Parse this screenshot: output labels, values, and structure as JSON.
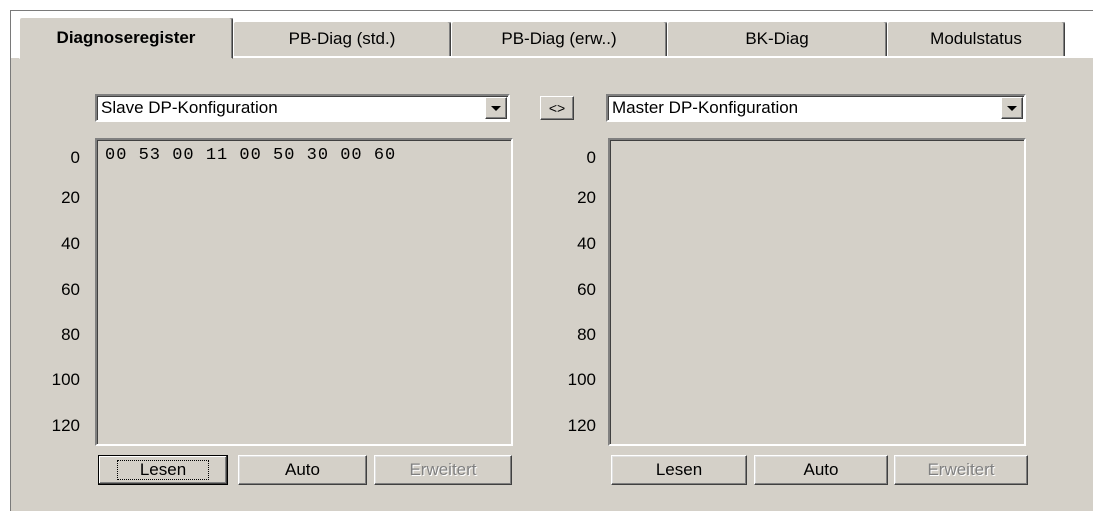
{
  "tabs": [
    {
      "label": "Diagnoseregister",
      "active": true
    },
    {
      "label": "PB-Diag (std.)",
      "active": false
    },
    {
      "label": "PB-Diag (erw..)",
      "active": false
    },
    {
      "label": "BK-Diag",
      "active": false
    },
    {
      "label": "Modulstatus",
      "active": false
    }
  ],
  "left": {
    "combo_value": "Slave DP-Konfiguration",
    "rows": [
      "0",
      "20",
      "40",
      "60",
      "80",
      "100",
      "120"
    ],
    "data_line": "00 53 00 11 00 50 30 00 60",
    "buttons": {
      "read": "Lesen",
      "auto": "Auto",
      "extended": "Erweitert"
    }
  },
  "swap_label": "<>",
  "right": {
    "combo_value": "Master DP-Konfiguration",
    "rows": [
      "0",
      "20",
      "40",
      "60",
      "80",
      "100",
      "120"
    ],
    "data_line": "",
    "buttons": {
      "read": "Lesen",
      "auto": "Auto",
      "extended": "Erweitert"
    }
  },
  "colors": {
    "face": "#d4d0c8",
    "shadow": "#808080",
    "highlight": "#ffffff"
  },
  "icons": {
    "dropdown": "chevron-down-icon"
  }
}
